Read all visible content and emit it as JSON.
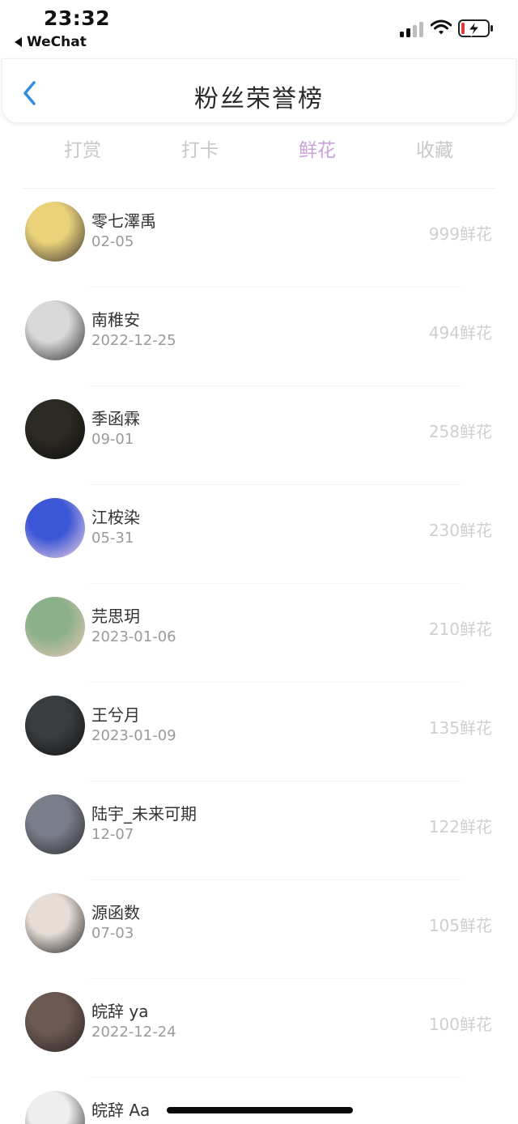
{
  "status_bar": {
    "time": "23:32",
    "back_app": "WeChat"
  },
  "nav": {
    "title": "粉丝荣誉榜"
  },
  "tabs": [
    {
      "label": "打赏",
      "active": false
    },
    {
      "label": "打卡",
      "active": false
    },
    {
      "label": "鲜花",
      "active": true
    },
    {
      "label": "收藏",
      "active": false
    }
  ],
  "colors": {
    "accent_tab": "#c9a3d8",
    "back_arrow": "#2f8de4"
  },
  "list": [
    {
      "name": "零七澤禹",
      "date": "02-05",
      "count": "999鲜花",
      "avatar_colors": [
        "#e9d27a",
        "#3c3333"
      ]
    },
    {
      "name": "南稚安",
      "date": "2022-12-25",
      "count": "494鲜花",
      "avatar_colors": [
        "#d9d9d9",
        "#2b2b2b"
      ]
    },
    {
      "name": "季函霖",
      "date": "09-01",
      "count": "258鲜花",
      "avatar_colors": [
        "#2c2a24",
        "#0d0d0b"
      ]
    },
    {
      "name": "江桉染",
      "date": "05-31",
      "count": "230鲜花",
      "avatar_colors": [
        "#3b56d6",
        "#f3d6e2"
      ]
    },
    {
      "name": "芫思玥",
      "date": "2023-01-06",
      "count": "210鲜花",
      "avatar_colors": [
        "#8bb08a",
        "#e7c7b6"
      ]
    },
    {
      "name": "王兮月",
      "date": "2023-01-09",
      "count": "135鲜花",
      "avatar_colors": [
        "#3a3d3f",
        "#111111"
      ]
    },
    {
      "name": "陆宇_未来可期",
      "date": "12-07",
      "count": "122鲜花",
      "avatar_colors": [
        "#7a7e8a",
        "#2a2a2e"
      ]
    },
    {
      "name": "源函数",
      "date": "07-03",
      "count": "105鲜花",
      "avatar_colors": [
        "#e6ddd7",
        "#1e1e1e"
      ]
    },
    {
      "name": "皖辞 ya",
      "date": "2022-12-24",
      "count": "100鲜花",
      "avatar_colors": [
        "#6b5a52",
        "#2b2222"
      ]
    },
    {
      "name": "皖辞 Aa",
      "date": "",
      "count": "",
      "avatar_colors": [
        "#eeeeee",
        "#222222"
      ]
    }
  ]
}
